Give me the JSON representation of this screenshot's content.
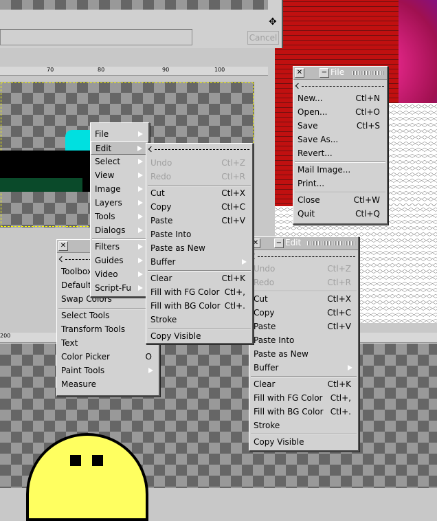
{
  "colors": {
    "accent": "#00e0e0",
    "menu_bg": "#d2d2d2",
    "disabled": "#a0a0a0"
  },
  "top_dialog": {
    "cancel_label": "Cancel"
  },
  "rulers": {
    "top_ticks": [
      "70",
      "80",
      "90",
      "100"
    ],
    "lower_tick": "200"
  },
  "image_menu": {
    "items": [
      {
        "label": "File"
      },
      {
        "label": "Edit"
      },
      {
        "label": "Select"
      },
      {
        "label": "View"
      },
      {
        "label": "Image"
      },
      {
        "label": "Layers"
      },
      {
        "label": "Tools"
      },
      {
        "label": "Dialogs"
      },
      {
        "label": "Filters"
      },
      {
        "label": "Guides"
      },
      {
        "label": "Video"
      },
      {
        "label": "Script-Fu"
      }
    ]
  },
  "edit_submenu": {
    "undo": {
      "label": "Undo",
      "accel": "Ctl+Z"
    },
    "redo": {
      "label": "Redo",
      "accel": "Ctl+R"
    },
    "cut": {
      "label": "Cut",
      "accel": "Ctl+X"
    },
    "copy": {
      "label": "Copy",
      "accel": "Ctl+C"
    },
    "paste": {
      "label": "Paste",
      "accel": "Ctl+V"
    },
    "paste_into": {
      "label": "Paste Into"
    },
    "paste_as_new": {
      "label": "Paste as New"
    },
    "buffer": {
      "label": "Buffer"
    },
    "clear": {
      "label": "Clear",
      "accel": "Ctl+K"
    },
    "fill_fg": {
      "label": "Fill with FG Color",
      "accel": "Ctl+,"
    },
    "fill_bg": {
      "label": "Fill with BG Color",
      "accel": "Ctl+."
    },
    "stroke": {
      "label": "Stroke"
    },
    "copy_visible": {
      "label": "Copy Visible"
    }
  },
  "file_window": {
    "title": "File",
    "items": [
      {
        "label": "New...",
        "accel": "Ctl+N"
      },
      {
        "label": "Open...",
        "accel": "Ctl+O"
      },
      {
        "label": "Save",
        "accel": "Ctl+S"
      },
      {
        "label": "Save As..."
      },
      {
        "label": "Revert..."
      },
      {
        "label": "Mail Image..."
      },
      {
        "label": "Print..."
      },
      {
        "label": "Close",
        "accel": "Ctl+W"
      },
      {
        "label": "Quit",
        "accel": "Ctl+Q"
      }
    ]
  },
  "tools_window": {
    "items": [
      {
        "label": "Toolbox"
      },
      {
        "label": "Default"
      },
      {
        "label": "Swap Colors"
      },
      {
        "label": "Select Tools"
      },
      {
        "label": "Transform Tools"
      },
      {
        "label": "Text"
      },
      {
        "label": "Color Picker",
        "accel": "O"
      },
      {
        "label": "Paint Tools"
      },
      {
        "label": "Measure"
      }
    ]
  },
  "edit_window": {
    "title": "Edit",
    "undo": {
      "label": "Undo",
      "accel": "Ctl+Z"
    },
    "redo": {
      "label": "Redo",
      "accel": "Ctl+R"
    },
    "cut": {
      "label": "Cut",
      "accel": "Ctl+X"
    },
    "copy": {
      "label": "Copy",
      "accel": "Ctl+C"
    },
    "paste": {
      "label": "Paste",
      "accel": "Ctl+V"
    },
    "paste_into": {
      "label": "Paste Into"
    },
    "paste_as_new": {
      "label": "Paste as New"
    },
    "buffer": {
      "label": "Buffer"
    },
    "clear": {
      "label": "Clear",
      "accel": "Ctl+K"
    },
    "fill_fg": {
      "label": "Fill with FG Color",
      "accel": "Ctl+,"
    },
    "fill_bg": {
      "label": "Fill with BG Color",
      "accel": "Ctl+."
    },
    "stroke": {
      "label": "Stroke"
    },
    "copy_visible": {
      "label": "Copy Visible"
    }
  }
}
